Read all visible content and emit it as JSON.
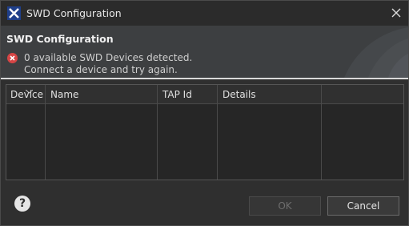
{
  "window": {
    "title": "SWD Configuration",
    "icon": "x-cube-icon",
    "close_icon": "close-icon"
  },
  "banner": {
    "title": "SWD Configuration",
    "error_icon": "error-icon",
    "message_line1": "0 available SWD Devices detected.",
    "message_line2": "Connect a device and try again."
  },
  "table": {
    "columns": [
      "Device",
      "Name",
      "TAP Id",
      "Details",
      ""
    ],
    "rows": []
  },
  "footer": {
    "help_icon": "help-icon",
    "help_label": "?",
    "ok_label": "OK",
    "cancel_label": "Cancel"
  },
  "colors": {
    "background": "#2f2f2f",
    "banner": "#3d3f41",
    "error": "#d64545"
  }
}
